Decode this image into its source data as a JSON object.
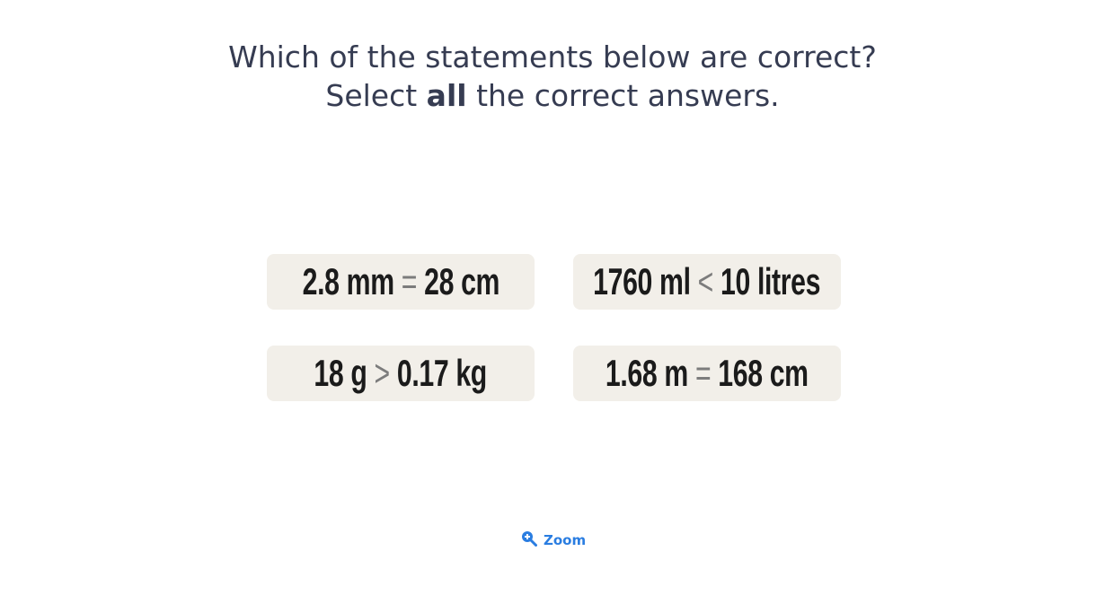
{
  "question": {
    "line1": "Which of the statements below are correct?",
    "line2_pre": "Select ",
    "line2_bold": "all",
    "line2_post": " the correct answers."
  },
  "options": [
    {
      "left": "2.8 mm",
      "op": "=",
      "right": "28 cm"
    },
    {
      "left": "1760 ml",
      "op": "<",
      "right": "10 litres"
    },
    {
      "left": "18 g",
      "op": ">",
      "right": "0.17 kg"
    },
    {
      "left": "1.68 m",
      "op": "=",
      "right": "168 cm"
    }
  ],
  "zoom": {
    "label": "Zoom",
    "icon": "zoom-in-icon"
  },
  "colors": {
    "accent": "#2a7de1",
    "card": "#f2efe9",
    "text": "#363c52"
  }
}
